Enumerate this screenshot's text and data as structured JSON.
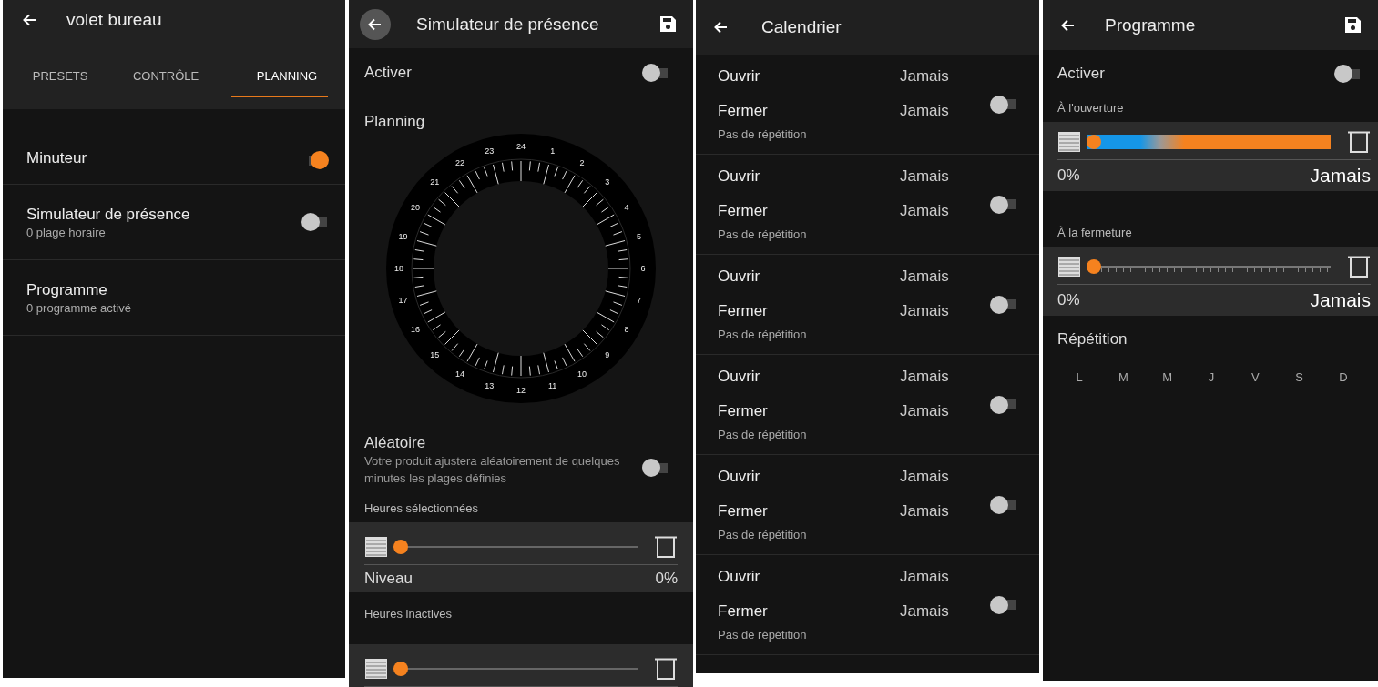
{
  "device": {
    "title": "volet bureau",
    "tabs": [
      {
        "label": "PRESETS",
        "selected": false
      },
      {
        "label": "CONTRÔLE",
        "selected": false
      },
      {
        "label": "PLANNING",
        "selected": true
      }
    ],
    "items": [
      {
        "title": "Minuteur",
        "on": true
      },
      {
        "title": "Simulateur de présence",
        "subtitle": "0 plage horaire",
        "on": false
      },
      {
        "title": "Programme",
        "subtitle": "0 programme activé"
      }
    ]
  },
  "presence": {
    "title": "Simulateur de présence",
    "activate": {
      "label": "Activer",
      "on": false
    },
    "planning_label": "Planning",
    "dial": {
      "hours": [
        "24",
        "23",
        "1",
        "22",
        "2",
        "21",
        "3",
        "20",
        "4",
        "19",
        "5",
        "18",
        "6",
        "17",
        "7",
        "16",
        "8",
        "15",
        "9",
        "14",
        "10",
        "13",
        "11",
        "12"
      ]
    },
    "random": {
      "title": "Aléatoire",
      "description": "Votre produit ajustera aléatoirement de quelques minutes les plages définies",
      "on": false
    },
    "slots": [
      {
        "heading": "Heures sélectionnées",
        "level": 0,
        "level_label": "Niveau",
        "reading": "0%"
      },
      {
        "heading": "Heures inactives",
        "level": 0
      }
    ]
  },
  "calendar": {
    "title": "Calendrier",
    "entries": [
      {
        "open_label": "Ouvrir",
        "open_value": "Jamais",
        "close_label": "Fermer",
        "close_value": "Jamais",
        "repeat": "Pas de répétition",
        "on": false
      },
      {
        "open_label": "Ouvrir",
        "open_value": "Jamais",
        "close_label": "Fermer",
        "close_value": "Jamais",
        "repeat": "Pas de répétition",
        "on": false
      },
      {
        "open_label": "Ouvrir",
        "open_value": "Jamais",
        "close_label": "Fermer",
        "close_value": "Jamais",
        "repeat": "Pas de répétition",
        "on": false
      },
      {
        "open_label": "Ouvrir",
        "open_value": "Jamais",
        "close_label": "Fermer",
        "close_value": "Jamais",
        "repeat": "Pas de répétition",
        "on": false
      },
      {
        "open_label": "Ouvrir",
        "open_value": "Jamais",
        "close_label": "Fermer",
        "close_value": "Jamais",
        "repeat": "Pas de répétition",
        "on": false
      },
      {
        "open_label": "Ouvrir",
        "open_value": "Jamais",
        "close_label": "Fermer",
        "close_value": "Jamais",
        "repeat": "Pas de répétition",
        "on": false
      }
    ]
  },
  "program": {
    "title": "Programme",
    "activate": {
      "label": "Activer",
      "on": false
    },
    "actions": [
      {
        "heading": "À l'ouverture",
        "kind": "gradient",
        "level": 0,
        "reading": "0%",
        "time": "Jamais"
      },
      {
        "heading": "À la fermeture",
        "kind": "ticked",
        "level": 0,
        "reading": "0%",
        "time": "Jamais"
      }
    ],
    "repeat_label": "Répétition",
    "days": [
      {
        "label": "L",
        "selected": false
      },
      {
        "label": "M",
        "selected": false
      },
      {
        "label": "M",
        "selected": false
      },
      {
        "label": "J",
        "selected": false
      },
      {
        "label": "V",
        "selected": false
      },
      {
        "label": "S",
        "selected": false
      },
      {
        "label": "D",
        "selected": false
      }
    ]
  }
}
